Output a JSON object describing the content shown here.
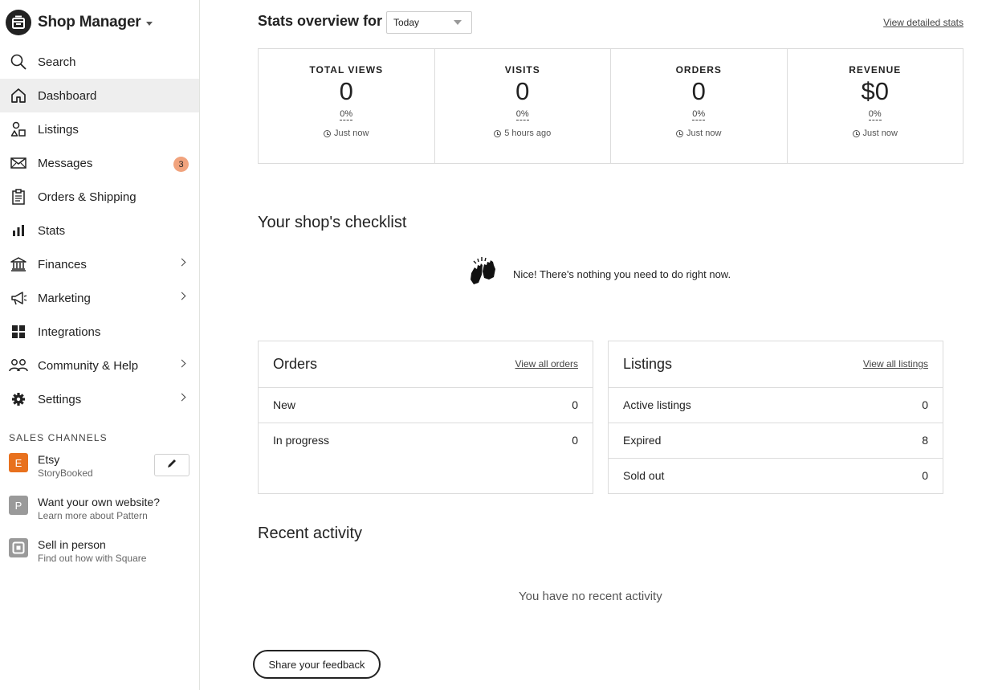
{
  "app": {
    "title": "Shop Manager"
  },
  "sidebar": {
    "items": [
      {
        "label": "Search",
        "icon": "search-icon"
      },
      {
        "label": "Dashboard",
        "icon": "home-icon",
        "active": true
      },
      {
        "label": "Listings",
        "icon": "shapes-icon"
      },
      {
        "label": "Messages",
        "icon": "envelope-icon",
        "badge": "3"
      },
      {
        "label": "Orders & Shipping",
        "icon": "clipboard-icon"
      },
      {
        "label": "Stats",
        "icon": "bar-chart-icon"
      },
      {
        "label": "Finances",
        "icon": "bank-icon",
        "has_submenu": true
      },
      {
        "label": "Marketing",
        "icon": "megaphone-icon",
        "has_submenu": true
      },
      {
        "label": "Integrations",
        "icon": "grid-icon"
      },
      {
        "label": "Community & Help",
        "icon": "people-icon",
        "has_submenu": true
      },
      {
        "label": "Settings",
        "icon": "gear-icon",
        "has_submenu": true
      }
    ],
    "sales_channels": {
      "heading": "SALES CHANNELS",
      "channels": [
        {
          "letter": "E",
          "title": "Etsy",
          "subtitle": "StoryBooked",
          "color": "#e8711e"
        },
        {
          "letter": "P",
          "title": "Want your own website?",
          "subtitle": "Learn more about Pattern",
          "color": "#9a9a9a"
        },
        {
          "letter": "",
          "title": "Sell in person",
          "subtitle": "Find out how with Square",
          "color": "#9a9a9a"
        }
      ]
    }
  },
  "stats": {
    "title": "Stats overview for",
    "period": "Today",
    "detailed_link": "View detailed stats",
    "cards": [
      {
        "label": "TOTAL VIEWS",
        "value": "0",
        "change": "0%",
        "time": "Just now"
      },
      {
        "label": "VISITS",
        "value": "0",
        "change": "0%",
        "time": "5 hours ago"
      },
      {
        "label": "ORDERS",
        "value": "0",
        "change": "0%",
        "time": "Just now"
      },
      {
        "label": "REVENUE",
        "value": "$0",
        "change": "0%",
        "time": "Just now"
      }
    ]
  },
  "checklist": {
    "title": "Your shop's checklist",
    "message": "Nice! There's nothing you need to do right now."
  },
  "orders_panel": {
    "title": "Orders",
    "link": "View all orders",
    "rows": [
      {
        "label": "New",
        "value": "0"
      },
      {
        "label": "In progress",
        "value": "0"
      }
    ]
  },
  "listings_panel": {
    "title": "Listings",
    "link": "View all listings",
    "rows": [
      {
        "label": "Active listings",
        "value": "0"
      },
      {
        "label": "Expired",
        "value": "8"
      },
      {
        "label": "Sold out",
        "value": "0"
      }
    ]
  },
  "recent_activity": {
    "title": "Recent activity",
    "empty_text": "You have no recent activity"
  },
  "feedback_button": "Share your feedback",
  "colors": {
    "badge": "#f1a37d",
    "active_nav_bg": "#eeeeee",
    "etsy_orange": "#e8711e",
    "border": "#dcdcdc"
  }
}
